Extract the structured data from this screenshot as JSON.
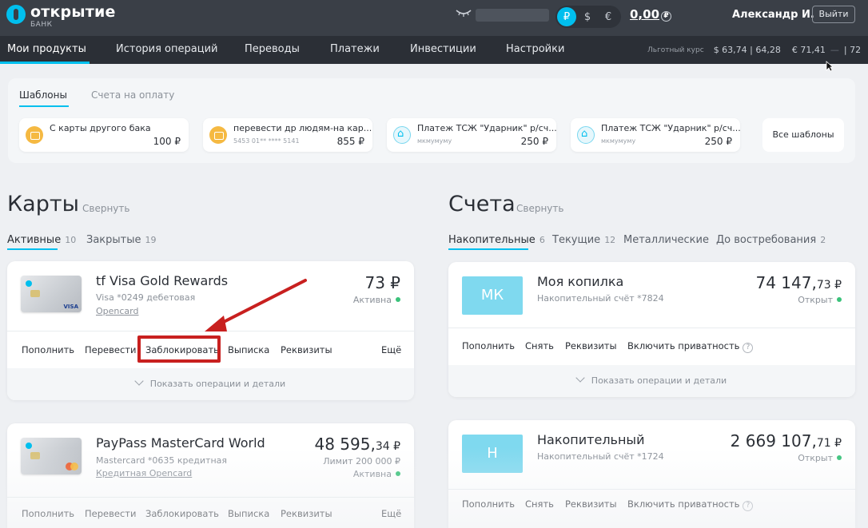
{
  "header": {
    "logo_name": "открытие",
    "logo_sub": "БАНК",
    "currencies": [
      "₽",
      "$",
      "€"
    ],
    "balance": "0,00",
    "username": "Александр И.",
    "logout_label": "Выйти"
  },
  "nav": {
    "items": [
      "Мои продукты",
      "История операций",
      "Переводы",
      "Платежи",
      "Инвестиции",
      "Настройки"
    ],
    "rate_label": "Льготный курс",
    "usd": "$  63,74 | 64,28",
    "eur": "€  71,41",
    "eur_tail": "| 72"
  },
  "templates": {
    "tabs": [
      "Шаблоны",
      "Счета на оплату"
    ],
    "cards": [
      {
        "name": "С карты другого бака",
        "sub": "",
        "amount": "100 ₽",
        "icon": "card-coin-icon"
      },
      {
        "name": "перевести др людям-на кар...",
        "sub": "5453 01** **** 5141",
        "amount": "855 ₽",
        "icon": "card-coin-icon"
      },
      {
        "name": "Платеж ТСЖ \"Ударник\" р/сч...",
        "sub": "мкмумуму",
        "amount": "250 ₽",
        "icon": "house-icon"
      },
      {
        "name": "Платеж ТСЖ \"Ударник\" р/сч...",
        "sub": "мкмумуму",
        "amount": "250 ₽",
        "icon": "house-icon"
      }
    ],
    "all_label": "Все шаблоны"
  },
  "cards_section": {
    "title": "Карты",
    "collapse": "Свернуть",
    "tabs": [
      {
        "label": "Активные",
        "count": "10"
      },
      {
        "label": "Закрытые",
        "count": "19"
      }
    ],
    "items": [
      {
        "name": "tf Visa Gold Rewards",
        "sub": "Visa *0249 дебетовая",
        "link": "Opencard",
        "amount": "73 ₽",
        "cents": "",
        "limit": "",
        "status": "Активна",
        "brand": "VISA",
        "actions": [
          "Пополнить",
          "Перевести",
          "Заблокировать",
          "Выписка",
          "Реквизиты",
          "Ещё"
        ],
        "footer": "Показать операции и детали"
      },
      {
        "name": "PayPass MasterCard World",
        "sub": "Mastercard *0635 кредитная",
        "link": "Кредитная Opencard",
        "amount": "48 595,",
        "cents": "34 ₽",
        "limit": "Лимит 200 000 ₽",
        "status": "Активна",
        "brand": "mastercard",
        "actions": [
          "Пополнить",
          "Перевести",
          "Заблокировать",
          "Выписка",
          "Реквизиты",
          "Ещё"
        ]
      }
    ]
  },
  "accounts_section": {
    "title": "Счета",
    "collapse": "Свернуть",
    "tabs": [
      {
        "label": "Накопительные",
        "count": "6"
      },
      {
        "label": "Текущие",
        "count": "12"
      },
      {
        "label": "Металлические",
        "count": ""
      },
      {
        "label": "До востребования",
        "count": "2"
      }
    ],
    "items": [
      {
        "badge": "МК",
        "name": "Моя копилка",
        "sub": "Накопительный счёт *7824",
        "amount": "74 147,",
        "cents": "73 ₽",
        "status": "Открыт",
        "actions": [
          "Пополнить",
          "Снять",
          "Реквизиты",
          "Включить приватность"
        ],
        "footer": "Показать операции и детали"
      },
      {
        "badge": "Н",
        "name": "Накопительный",
        "sub": "Накопительный счёт *1724",
        "amount": "2 669 107,",
        "cents": "71 ₽",
        "status": "Открыт",
        "actions": [
          "Пополнить",
          "Снять",
          "Реквизиты",
          "Включить приватность"
        ]
      }
    ]
  },
  "colors": {
    "accent": "#00bfee",
    "header_bg": "#3a3f47",
    "nav_bg": "#2b2f36",
    "annotation_red": "#c8201f",
    "status_green": "#3ac27a"
  }
}
